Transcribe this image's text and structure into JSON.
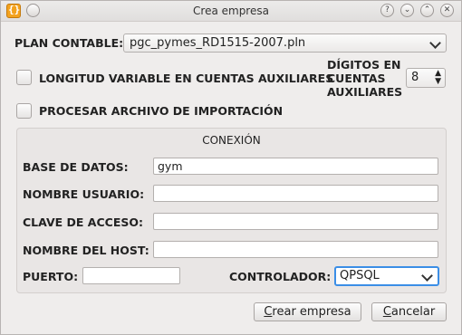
{
  "window": {
    "title": "Crea empresa",
    "controls": [
      "?",
      "⌄",
      "⌃",
      "✕"
    ]
  },
  "plan": {
    "label": "PLAN CONTABLE:",
    "selected": "pgc_pymes_RD1515-2007.pln"
  },
  "options": {
    "longitud_label": "LONGITUD VARIABLE EN CUENTAS AUXILIARES",
    "longitud_checked": false,
    "digitos_label_1": "DÍGITOS EN",
    "digitos_label_2": "CUENTAS",
    "digitos_label_3": "AUXILIARES",
    "digitos_value": "8",
    "procesar_label": "PROCESAR ARCHIVO DE IMPORTACIÓN",
    "procesar_checked": false
  },
  "conexion": {
    "title": "CONEXIÓN",
    "base_label": "BASE DE DATOS:",
    "base_value": "gym",
    "usuario_label": "NOMBRE USUARIO:",
    "usuario_value": "",
    "clave_label": "CLAVE DE ACCESO:",
    "clave_value": "",
    "host_label": "NOMBRE DEL HOST:",
    "host_value": "",
    "puerto_label": "PUERTO:",
    "puerto_value": "",
    "controlador_label": "CONTROLADOR:",
    "controlador_value": "QPSQL"
  },
  "buttons": {
    "crear_first": "C",
    "crear_rest": "rear empresa",
    "cancelar_first": "C",
    "cancelar_rest": "ancelar"
  }
}
